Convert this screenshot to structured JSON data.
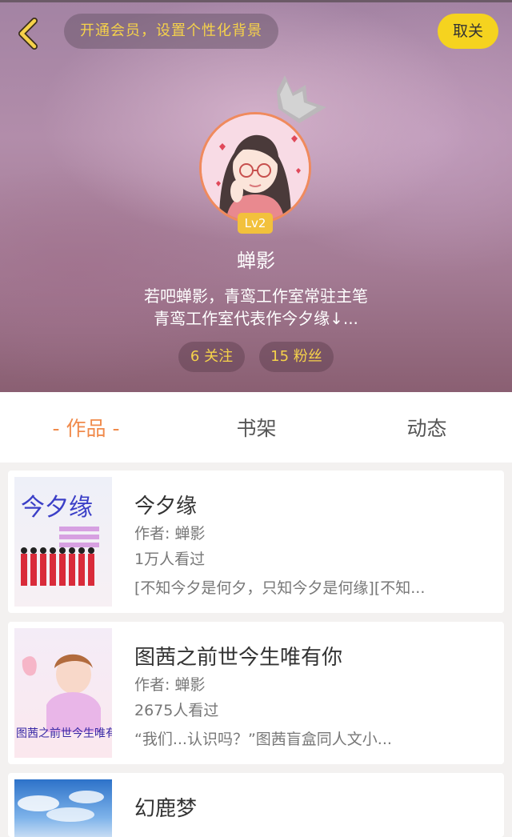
{
  "header": {
    "vip_prompt": "开通会员，设置个性化背景",
    "unfollow_label": "取关",
    "level": "Lv2",
    "username": "蝉影",
    "bio_line1": "若吧蝉影，青鸾工作室常驻主笔",
    "bio_line2": "青鸾工作室代表作今夕缘↓...",
    "following": "6 关注",
    "fans": "15 粉丝",
    "accent_color": "#f5d31f"
  },
  "tabs": [
    {
      "label": "- 作品 -",
      "active": true
    },
    {
      "label": "书架",
      "active": false
    },
    {
      "label": "动态",
      "active": false
    }
  ],
  "books": [
    {
      "title": "今夕缘",
      "author": "作者: 蝉影",
      "views": "1万人看过",
      "desc": "[不知今夕是何夕，只知今夕是何缘][不知...",
      "cover_text": "今夕缘"
    },
    {
      "title": "图茜之前世今生唯有你",
      "author": "作者: 蝉影",
      "views": "2675人看过",
      "desc": "“我们...认识吗？”图茜盲盒同人文小...",
      "cover_text": "图茜之前世今生唯有你"
    },
    {
      "title": "幻鹿梦",
      "author": "",
      "views": "",
      "desc": ""
    }
  ]
}
